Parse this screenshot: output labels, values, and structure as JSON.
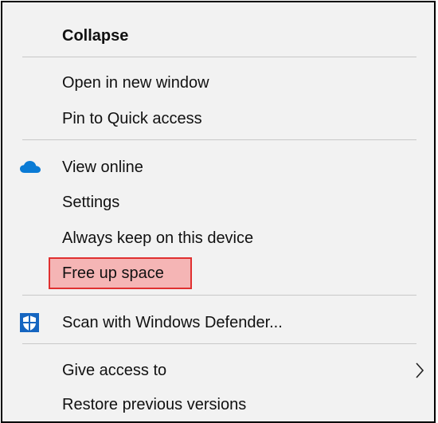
{
  "menu": {
    "items": [
      {
        "label": "Collapse"
      },
      {
        "label": "Open in new window"
      },
      {
        "label": "Pin to Quick access"
      },
      {
        "label": "View online",
        "icon": "onedrive-cloud-icon"
      },
      {
        "label": "Settings"
      },
      {
        "label": "Always keep on this device"
      },
      {
        "label": "Free up space",
        "highlighted": true
      },
      {
        "label": "Scan with Windows Defender...",
        "icon": "windows-defender-shield-icon"
      },
      {
        "label": "Give access to",
        "icon": "chevron-right-icon"
      },
      {
        "label": "Restore previous versions"
      }
    ]
  },
  "colors": {
    "menu_background": "#f2f2f2",
    "highlight_fill": "#f5b5b5",
    "highlight_border": "#e03030",
    "onedrive_blue": "#0a7bd5",
    "defender_blue": "#1565c0"
  }
}
